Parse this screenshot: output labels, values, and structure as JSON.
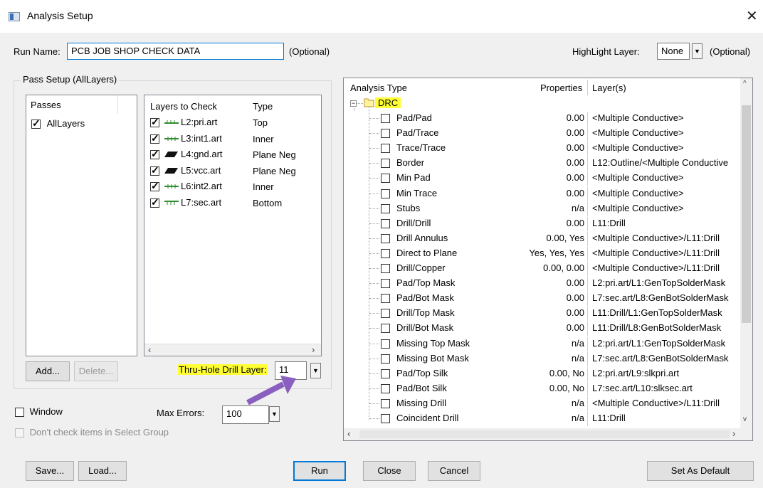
{
  "window": {
    "title": "Analysis Setup"
  },
  "run_name": {
    "label": "Run Name:",
    "value": "PCB JOB SHOP CHECK DATA",
    "optional": "(Optional)"
  },
  "highlight_layer": {
    "label": "HighLight Layer:",
    "value": "None",
    "optional": "(Optional)"
  },
  "pass_setup": {
    "title": "Pass Setup (AllLayers)",
    "passes_header": "Passes",
    "passes": [
      {
        "label": "AllLayers",
        "checked": true
      }
    ],
    "layers_header": "Layers to Check",
    "type_header": "Type",
    "layers": [
      {
        "name": "L2:pri.art",
        "type": "Top",
        "checked": true,
        "icon": "top-layer-icon"
      },
      {
        "name": "L3:int1.art",
        "type": "Inner",
        "checked": true,
        "icon": "inner-layer-icon"
      },
      {
        "name": "L4:gnd.art",
        "type": "Plane Neg",
        "checked": true,
        "icon": "plane-layer-icon"
      },
      {
        "name": "L5:vcc.art",
        "type": "Plane Neg",
        "checked": true,
        "icon": "plane-layer-icon"
      },
      {
        "name": "L6:int2.art",
        "type": "Inner",
        "checked": true,
        "icon": "inner-layer-icon"
      },
      {
        "name": "L7:sec.art",
        "type": "Bottom",
        "checked": true,
        "icon": "bottom-layer-icon"
      }
    ],
    "add_label": "Add...",
    "delete_label": "Delete...",
    "drill_layer_label": "Thru-Hole Drill Layer:",
    "drill_layer_value": "11"
  },
  "window_option": {
    "label": "Window",
    "checked": false
  },
  "max_errors": {
    "label": "Max Errors:",
    "value": "100"
  },
  "select_group": {
    "label": "Don't check items in Select Group",
    "checked": false
  },
  "analysis": {
    "headers": {
      "type": "Analysis Type",
      "properties": "Properties",
      "layers": "Layer(s)"
    },
    "root": {
      "label": "DRC"
    },
    "rows": [
      {
        "type": "Pad/Pad",
        "properties": "0.00",
        "layers": "<Multiple Conductive>"
      },
      {
        "type": "Pad/Trace",
        "properties": "0.00",
        "layers": "<Multiple Conductive>"
      },
      {
        "type": "Trace/Trace",
        "properties": "0.00",
        "layers": "<Multiple Conductive>"
      },
      {
        "type": "Border",
        "properties": "0.00",
        "layers": "L12:Outline/<Multiple Conductive"
      },
      {
        "type": "Min Pad",
        "properties": "0.00",
        "layers": "<Multiple Conductive>"
      },
      {
        "type": "Min Trace",
        "properties": "0.00",
        "layers": "<Multiple Conductive>"
      },
      {
        "type": "Stubs",
        "properties": "n/a",
        "layers": "<Multiple Conductive>"
      },
      {
        "type": "Drill/Drill",
        "properties": "0.00",
        "layers": "L11:Drill"
      },
      {
        "type": "Drill Annulus",
        "properties": "0.00, Yes",
        "layers": "<Multiple Conductive>/L11:Drill"
      },
      {
        "type": "Direct to Plane",
        "properties": "Yes, Yes, Yes",
        "layers": "<Multiple Conductive>/L11:Drill"
      },
      {
        "type": "Drill/Copper",
        "properties": "0.00, 0.00",
        "layers": "<Multiple Conductive>/L11:Drill"
      },
      {
        "type": "Pad/Top Mask",
        "properties": "0.00",
        "layers": "L2:pri.art/L1:GenTopSolderMask"
      },
      {
        "type": "Pad/Bot Mask",
        "properties": "0.00",
        "layers": "L7:sec.art/L8:GenBotSolderMask"
      },
      {
        "type": "Drill/Top Mask",
        "properties": "0.00",
        "layers": "L11:Drill/L1:GenTopSolderMask"
      },
      {
        "type": "Drill/Bot Mask",
        "properties": "0.00",
        "layers": "L11:Drill/L8:GenBotSolderMask"
      },
      {
        "type": "Missing Top Mask",
        "properties": "n/a",
        "layers": "L2:pri.art/L1:GenTopSolderMask"
      },
      {
        "type": "Missing Bot Mask",
        "properties": "n/a",
        "layers": "L7:sec.art/L8:GenBotSolderMask"
      },
      {
        "type": "Pad/Top Silk",
        "properties": "0.00, No",
        "layers": "L2:pri.art/L9:slkpri.art"
      },
      {
        "type": "Pad/Bot Silk",
        "properties": "0.00, No",
        "layers": "L7:sec.art/L10:slksec.art"
      },
      {
        "type": "Missing Drill",
        "properties": "n/a",
        "layers": "<Multiple Conductive>/L11:Drill"
      },
      {
        "type": "Coincident Drill",
        "properties": "n/a",
        "layers": "L11:Drill"
      }
    ]
  },
  "buttons": {
    "save": "Save...",
    "load": "Load...",
    "run": "Run",
    "close": "Close",
    "cancel": "Cancel",
    "set_default": "Set As Default"
  },
  "colors": {
    "highlight": "#ffff33",
    "accent": "#0078d7",
    "arrow": "#8b5fbf",
    "layer_icon": "#2e8b2e"
  }
}
